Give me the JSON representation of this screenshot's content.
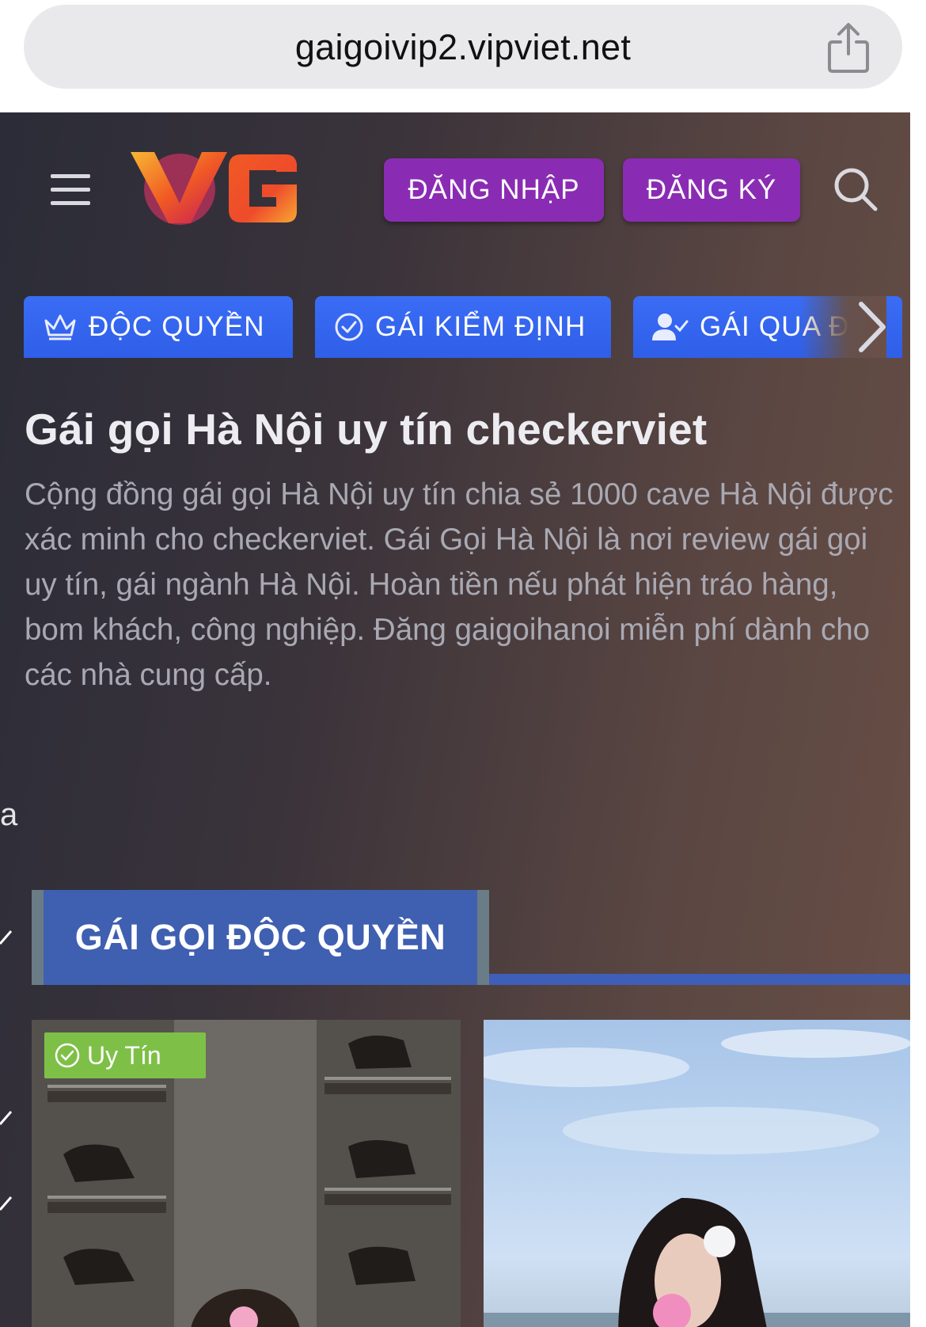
{
  "browser": {
    "url": "gaigoivip2.vipviet.net",
    "share_icon": "share-icon"
  },
  "header": {
    "logo_text": "VG",
    "login_label": "ĐĂNG NHẬP",
    "register_label": "ĐĂNG KÝ",
    "menu_icon": "hamburger-menu-icon",
    "search_icon": "search-icon",
    "button_color": "#8a2cb3"
  },
  "categories": [
    {
      "label": "ĐỘC QUYỀN",
      "icon": "crown-icon"
    },
    {
      "label": "GÁI KIỂM ĐỊNH",
      "icon": "check-circle-icon"
    },
    {
      "label": "GÁI QUA Đ",
      "icon": "user-check-icon"
    }
  ],
  "hero": {
    "title": "Gái gọi Hà Nội uy tín checkerviet",
    "description": "Cộng đồng gái gọi Hà Nội uy tín chia sẻ 1000 cave Hà Nội được xác minh cho checkerviet. Gái Gọi Hà Nội là nơi review gái gọi uy tín, gái ngành Hà Nội. Hoàn tiền nếu phát hiện tráo hàng, bom khách, công nghiệp. Đăng gaigoihanoi miễn phí dành cho các nhà cung cấp."
  },
  "stray_text": "a",
  "section": {
    "title": "GÁI GỌI ĐỘC QUYỀN",
    "accent": "#3f5fb0"
  },
  "cards": [
    {
      "badge": "Uy Tín",
      "badge_color": "#7ec047"
    },
    {}
  ]
}
